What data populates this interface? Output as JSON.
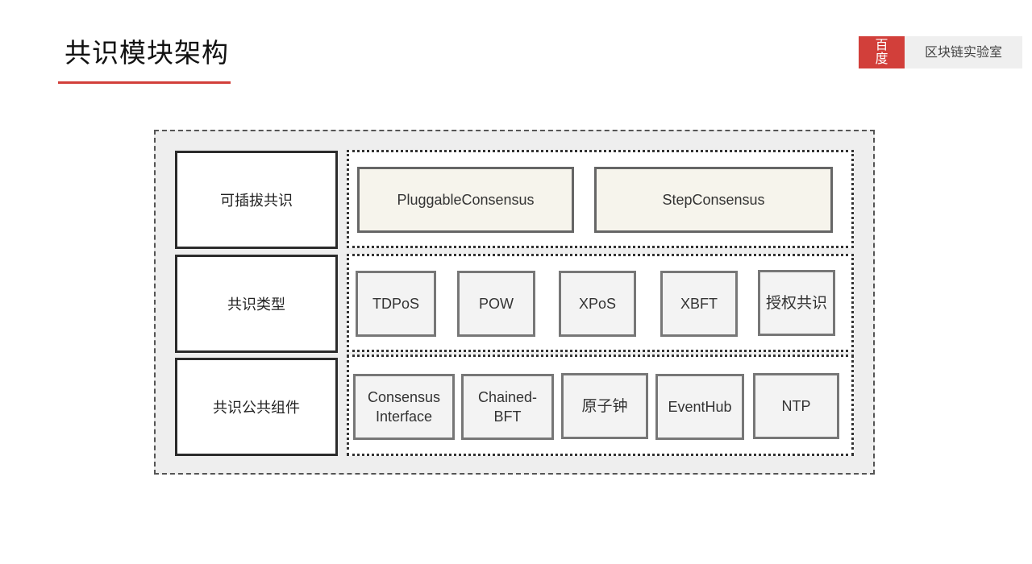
{
  "header": {
    "title": "共识模块架构",
    "accent_color": "#d23f3a"
  },
  "badge": {
    "logo_line1": "百",
    "logo_line2": "度",
    "text": "区块链实验室"
  },
  "diagram": {
    "rows": [
      {
        "label": "可插拔共识",
        "items": [
          "PluggableConsensus",
          "StepConsensus"
        ]
      },
      {
        "label": "共识类型",
        "items": [
          "TDPoS",
          "POW",
          "XPoS",
          "XBFT",
          "授权共识"
        ]
      },
      {
        "label": "共识公共组件",
        "items": [
          "Consensus Interface",
          "Chained-BFT",
          "原子钟",
          "EventHub",
          "NTP"
        ]
      }
    ],
    "row3_item0_line1": "Consensus",
    "row3_item0_line2": "Interface",
    "row3_item1_line1": "Chained-",
    "row3_item1_line2": "BFT"
  }
}
